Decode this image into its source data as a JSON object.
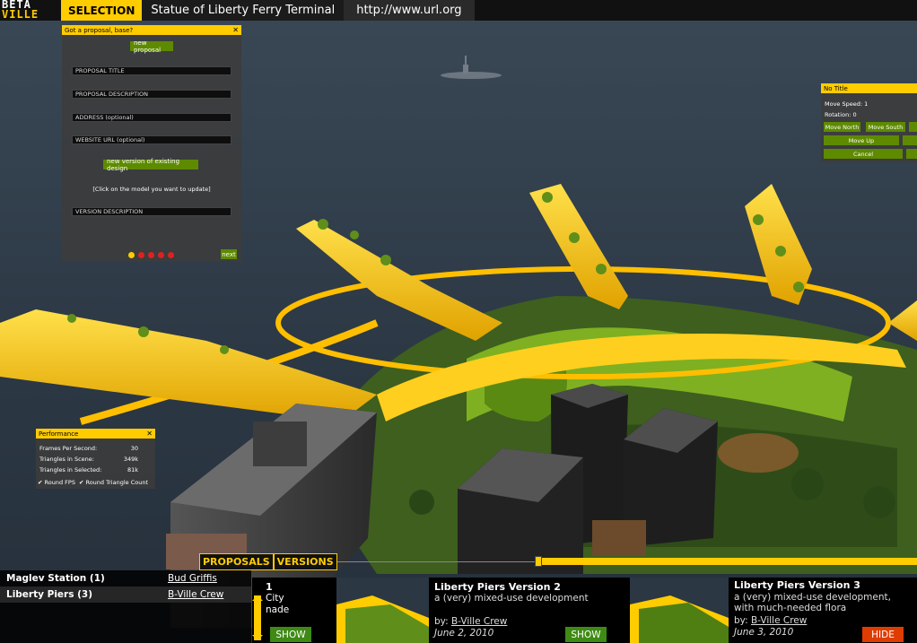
{
  "topbar": {
    "logo_top": "BETA",
    "logo_bottom": "VILLE",
    "selection_label": "SELECTION",
    "title": "Statue of Liberty Ferry Terminal",
    "url": "http://www.url.org"
  },
  "proposal_panel": {
    "title": "Got a proposal, base?",
    "close": "✕",
    "new_proposal": "new proposal",
    "fields": [
      {
        "placeholder": "PROPOSAL TITLE"
      },
      {
        "placeholder": "PROPOSAL DESCRIPTION"
      },
      {
        "placeholder": "ADDRESS (optional)"
      },
      {
        "placeholder": "WEBSITE URL (optional)"
      }
    ],
    "new_version_btn": "new version of existing design",
    "click_note": "[Click on the model you want to update]",
    "version_description": "VERSION DESCRIPTION",
    "next": "next",
    "step_count": 5,
    "active_step": 1
  },
  "move_panel": {
    "title": "No Title",
    "move_speed_label": "Move Speed:",
    "move_speed_value": "1",
    "rotation_label": "Rotation:",
    "rotation_value": "0",
    "move_north": "Move North",
    "move_south": "Move South",
    "move_up": "Move Up",
    "cancel": "Cancel"
  },
  "performance": {
    "title": "Performance",
    "close": "✕",
    "rows": [
      {
        "label": "Frames Per Second:",
        "value": "30"
      },
      {
        "label": "Triangles in Scene:",
        "value": "349k"
      },
      {
        "label": "Triangles in Selected:",
        "value": "81k"
      }
    ],
    "check_round_fps": "Round FPS",
    "check_round_triangle": "Round Triangle Count"
  },
  "tabs": {
    "proposals": "PROPOSALS",
    "versions": "VERSIONS"
  },
  "proposals": [
    {
      "name": "Maglev Station",
      "count": "(1)",
      "author": "Bud Griffis"
    },
    {
      "name": "Liberty Piers",
      "count": "(3)",
      "author": "B-Ville Crew"
    }
  ],
  "versions": {
    "v1_number": "1",
    "v1_line1": "City",
    "v1_line2": "nade",
    "v1_show": "SHOW",
    "v2_title": "Liberty Piers Version 2",
    "v2_desc": "a (very) mixed-use development",
    "v2_by_label": "by:",
    "v2_author": "B-Ville Crew",
    "v2_date": "June 2, 2010",
    "v2_show": "SHOW",
    "v3_title": "Liberty Piers Version 3",
    "v3_desc1": "a (very) mixed-use development,",
    "v3_desc2": "with much-needed flora",
    "v3_by_label": "by:",
    "v3_author": "B-Ville Crew",
    "v3_date": "June 3, 2010",
    "v3_hide": "HIDE"
  },
  "colors": {
    "accent_yellow": "#ffcc00",
    "button_green": "#5e8a00",
    "show_green": "#3e8a14",
    "hide_red": "#e03c00",
    "water": "#2d3a47"
  }
}
